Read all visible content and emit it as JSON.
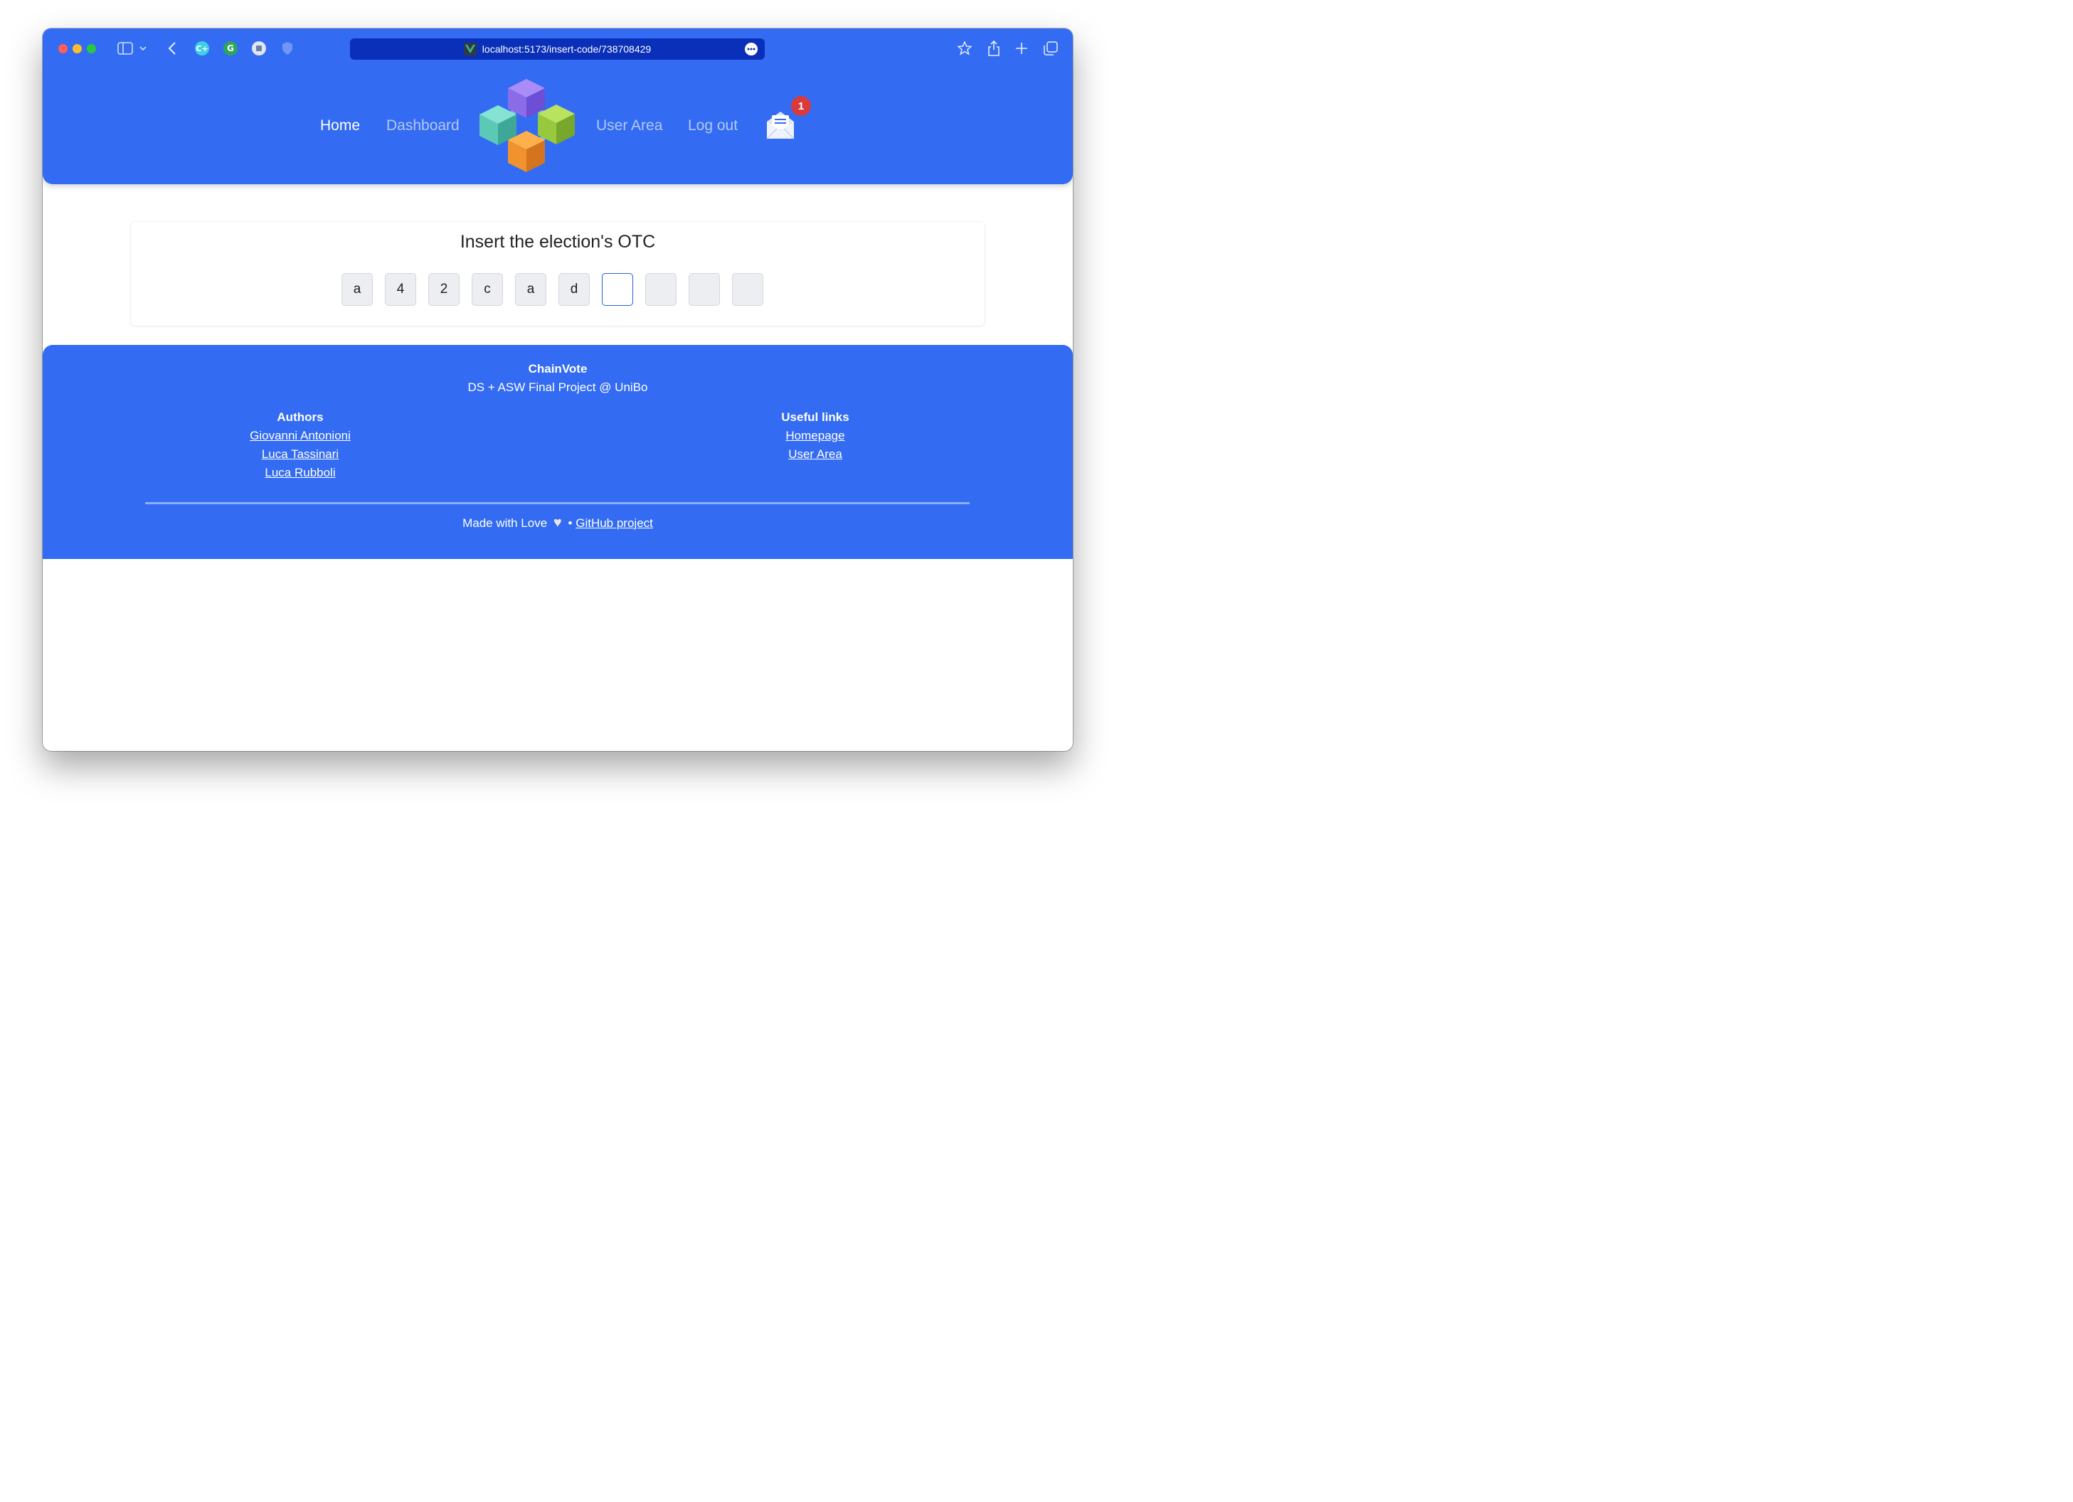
{
  "browser": {
    "url": "localhost:5173/insert-code/738708429"
  },
  "nav": {
    "home": "Home",
    "dashboard": "Dashboard",
    "user_area": "User Area",
    "logout": "Log out",
    "notification_count": "1"
  },
  "otc": {
    "title": "Insert the election's OTC",
    "digits": [
      "a",
      "4",
      "2",
      "c",
      "a",
      "d",
      "",
      "",
      "",
      ""
    ],
    "focused_index": 6
  },
  "footer": {
    "brand": "ChainVote",
    "subtitle": "DS + ASW Final Project @ UniBo",
    "authors_heading": "Authors",
    "authors": [
      "Giovanni Antonioni",
      "Luca Tassinari",
      "Luca Rubboli"
    ],
    "links_heading": "Useful links",
    "links": [
      "Homepage",
      "User Area"
    ],
    "made_with": "Made with Love",
    "separator": "•",
    "github": "GitHub project"
  },
  "colors": {
    "primary": "#336cf2",
    "url_bar": "#0a2fb8",
    "badge": "#d93a3a",
    "focus_border": "#2a61d6"
  }
}
